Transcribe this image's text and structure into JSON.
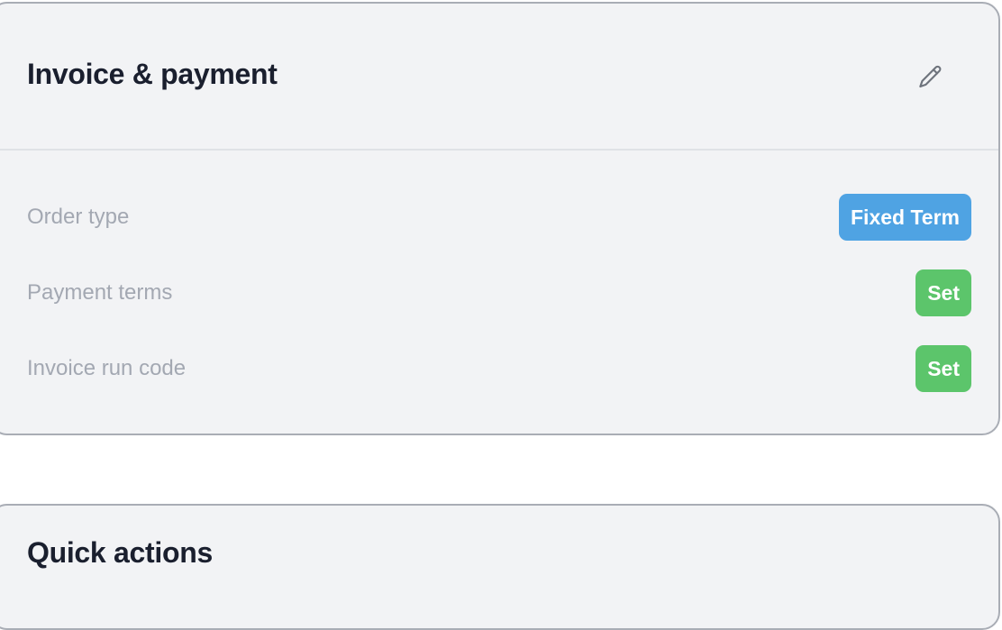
{
  "invoice_card": {
    "title": "Invoice & payment",
    "edit_icon": "pencil-icon",
    "rows": [
      {
        "label": "Order type",
        "value": "Fixed Term",
        "color": "#4fa3e3"
      },
      {
        "label": "Payment terms",
        "value": "Set",
        "color": "#5cc56b"
      },
      {
        "label": "Invoice run code",
        "value": "Set",
        "color": "#5cc56b"
      }
    ]
  },
  "quick_actions_card": {
    "title": "Quick actions"
  }
}
